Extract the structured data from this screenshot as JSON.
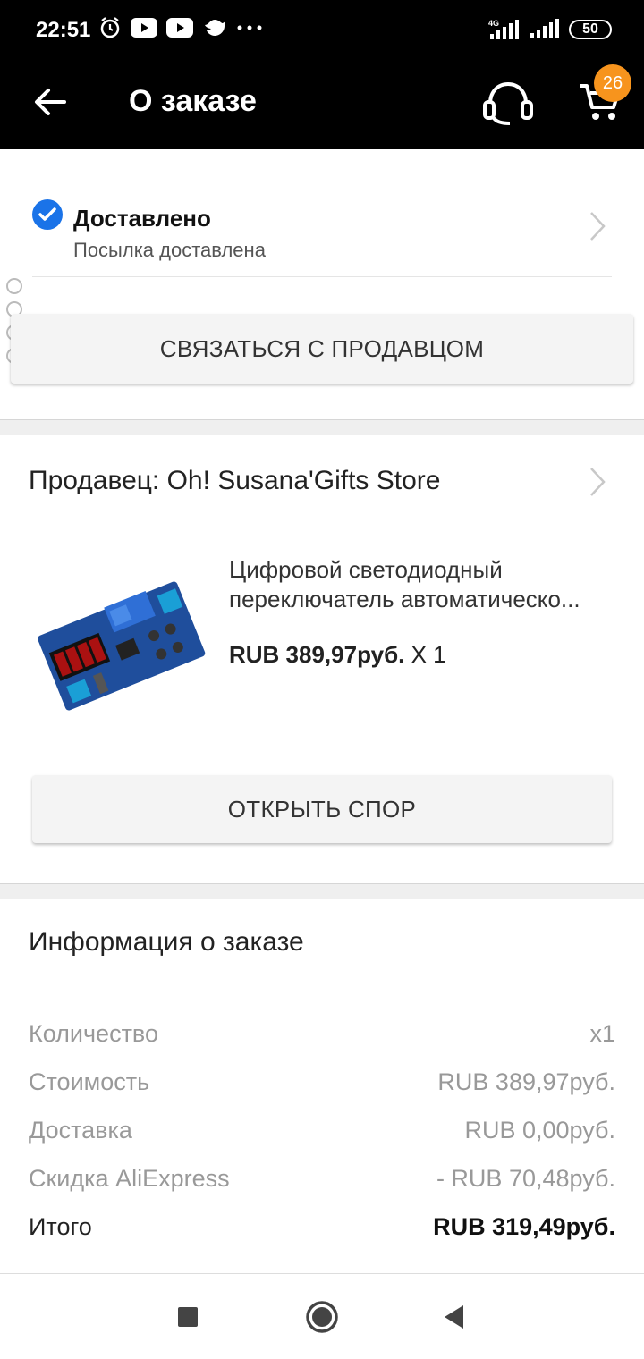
{
  "status_bar": {
    "time": "22:51",
    "icons_left": [
      "alarm-icon",
      "youtube-icon",
      "youtube-icon",
      "bird-icon",
      "more-dots-icon"
    ],
    "network": "4G",
    "battery": "50"
  },
  "app_bar": {
    "title": "О заказе",
    "cart_count": "26",
    "badge_color": "#f7941d"
  },
  "order_status": {
    "title": "Доставлено",
    "subtitle": "Посылка доставлена",
    "check_color": "#1a73e8"
  },
  "contact_seller_label": "СВЯЗАТЬСЯ С ПРОДАВЦОМ",
  "seller": {
    "label": "Продавец: Oh! Susana'Gifts Store"
  },
  "product": {
    "title_line1": "Цифровой светодиодный",
    "title_line2": "переключатель автоматическо...",
    "price": "RUB 389,97руб.",
    "quantity": "X 1"
  },
  "open_dispute_label": "ОТКРЫТЬ СПОР",
  "order_info": {
    "title": "Информация о заказе",
    "rows": [
      {
        "label": "Количество",
        "value": "x1"
      },
      {
        "label": "Стоимость",
        "value": "RUB 389,97руб."
      },
      {
        "label": "Доставка",
        "value": "RUB 0,00руб."
      },
      {
        "label": "Скидка AliExpress",
        "value": "- RUB 70,48руб."
      },
      {
        "label": "Итого",
        "value": "RUB 319,49руб."
      }
    ]
  },
  "nav": [
    "recents-icon",
    "home-icon",
    "back-icon"
  ]
}
